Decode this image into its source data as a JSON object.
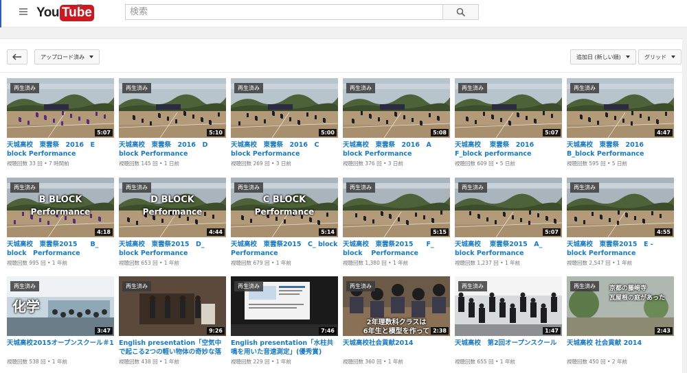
{
  "masthead": {
    "logo_you": "You",
    "logo_tube": "Tube",
    "logo_region": "JP",
    "search_placeholder": "検索"
  },
  "toolbar": {
    "filter_label": "アップロード済み",
    "sort_label": "追加日 (新しい順)",
    "view_label": "グリッド"
  },
  "colors": {
    "link": "#167ac6",
    "logo_red": "#cc181e",
    "meta": "#767676"
  },
  "watched_badge": "再生済み",
  "videos": [
    {
      "title": "天城高校　東雲祭　2016　E block Performance",
      "views": "視聴回数 33 回",
      "age": "7 時間前",
      "duration": "5:07",
      "thumb": "field"
    },
    {
      "title": "天城高校　東雲祭　2016　D block Performance",
      "views": "視聴回数 145 回",
      "age": "1 日前",
      "duration": "5:10",
      "thumb": "field"
    },
    {
      "title": "天城高校　東雲祭　2016　C block Performance",
      "views": "視聴回数 269 回",
      "age": "3 日前",
      "duration": "5:00",
      "thumb": "field"
    },
    {
      "title": "天城高校　東雲祭　2016　A block Performance",
      "views": "視聴回数 376 回",
      "age": "3 日前",
      "duration": "5:08",
      "thumb": "field"
    },
    {
      "title": "天城高校　 東雲祭　2016 F_block performance",
      "views": "視聴回数 609 回",
      "age": "5 日前",
      "duration": "5:07",
      "thumb": "field"
    },
    {
      "title": "天城高校　東雲祭　2016　B_block Performance",
      "views": "視聴回数 595 回",
      "age": "5 日前",
      "duration": "4:47",
      "thumb": "field"
    },
    {
      "title": "天城高校　東雲祭2015　　B_ block　Performance",
      "views": "視聴回数 995 回",
      "age": "1 年前",
      "duration": "4:18",
      "thumb": "field2",
      "overlay1": "B  BLOCK",
      "overlay2": "Performance"
    },
    {
      "title": "天城高校　東雲祭2015　D_ block Performance",
      "views": "視聴回数 653 回",
      "age": "1 年前",
      "duration": "4:44",
      "thumb": "field2",
      "overlay1": "D  BLOCK",
      "overlay2": "Performance"
    },
    {
      "title": "天城高校　東雲祭2015　C_ block Performance",
      "views": "視聴回数 679 回",
      "age": "1 年前",
      "duration": "5:14",
      "thumb": "field2",
      "overlay1": "C  BLOCK",
      "overlay2": "Performance"
    },
    {
      "title": "天城高校　東雲祭2015　　F_ block　 Performance",
      "views": "視聴回数 1,380 回",
      "age": "1 年前",
      "duration": "5:15",
      "thumb": "field2"
    },
    {
      "title": "天城高校　 東雲祭2015　A_ block Performance",
      "views": "視聴回数 1,237 回",
      "age": "1 年前",
      "duration": "5:07",
      "thumb": "field2"
    },
    {
      "title": "天城高校　東雲祭2015　E - block Performance",
      "views": "視聴回数 2,547 回",
      "age": "1 年前",
      "duration": "4:55",
      "thumb": "field2"
    },
    {
      "title": "天城高校2015オープンスクール＃1",
      "views": "視聴回数 538 回",
      "age": "1 年前",
      "duration": "3:47",
      "thumb": "classroom",
      "overlay1": "化学"
    },
    {
      "title": "English presentation「空気中で起こる2つの軽い物体の奇妙な落下…",
      "views": "視聴回数 438 回",
      "age": "1 年前",
      "duration": "9:26",
      "thumb": "stage"
    },
    {
      "title": "English presentation「水柱共鳴を用いた音速測定」(優秀賞)",
      "views": "視聴回数 229 回",
      "age": "1 年前",
      "duration": "7:46",
      "thumb": "screen"
    },
    {
      "title": "天城高校社会貢献2014",
      "views": "視聴回数 360 回",
      "age": "1 年前",
      "duration": "2:38",
      "thumb": "kids",
      "overlay1": "2年理数科クラスは",
      "overlay2": "6年生と模型を作って"
    },
    {
      "title": "天城高校　第2回オープンスクール",
      "views": "視聴回数 655 回",
      "age": "1 年前",
      "duration": "1:47",
      "thumb": "band"
    },
    {
      "title": "天城高校 社会貢献 2014",
      "views": "視聴回数 450 回",
      "age": "2 年前",
      "duration": "2:43",
      "thumb": "garden",
      "overlay1": "京都の藤﨑寺",
      "overlay2": "瓦屋根の庭があった"
    }
  ]
}
